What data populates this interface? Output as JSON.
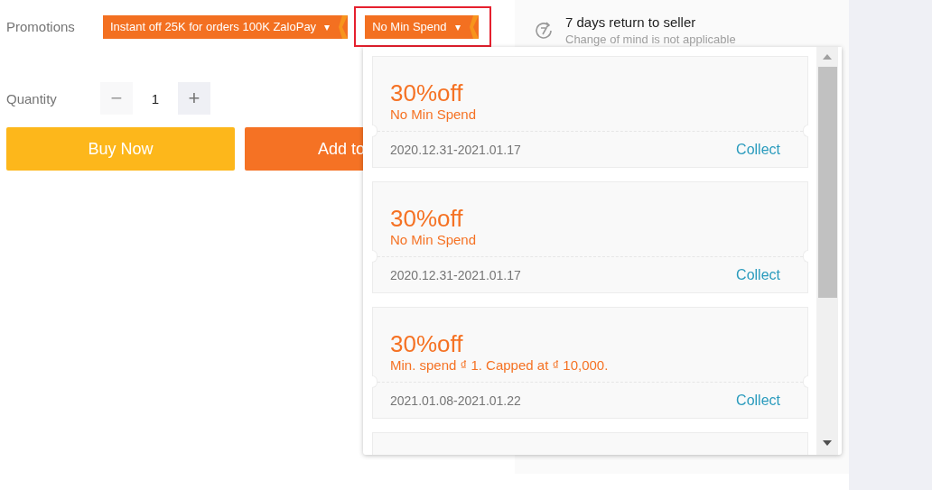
{
  "promotions": {
    "label": "Promotions",
    "tags": [
      {
        "label": "Instant off 25K for orders 100K ZaloPay",
        "caret": "▾",
        "highlighted": false
      },
      {
        "label": "No Min Spend",
        "caret": "▾",
        "highlighted": true
      }
    ]
  },
  "quantity": {
    "label": "Quantity",
    "minus": "−",
    "value": "1",
    "plus": "+",
    "minus_disabled": true
  },
  "buttons": [
    {
      "label": "Buy Now",
      "kind": "buy"
    },
    {
      "label": "Add to",
      "kind": "cart"
    }
  ],
  "warranty": {
    "title": "7 days return to seller",
    "subtitle": "Change of mind is not applicable"
  },
  "coupons": [
    {
      "discount": "30%off",
      "condition": "No Min Spend",
      "validity": "2020.12.31-2021.01.17",
      "action": "Collect"
    },
    {
      "discount": "30%off",
      "condition": "No Min Spend",
      "validity": "2020.12.31-2021.01.17",
      "action": "Collect"
    },
    {
      "discount": "30%off",
      "condition": "Min. spend ₫ 1. Capped at ₫ 10,000.",
      "validity": "2021.01.08-2021.01.22",
      "action": "Collect"
    }
  ]
}
